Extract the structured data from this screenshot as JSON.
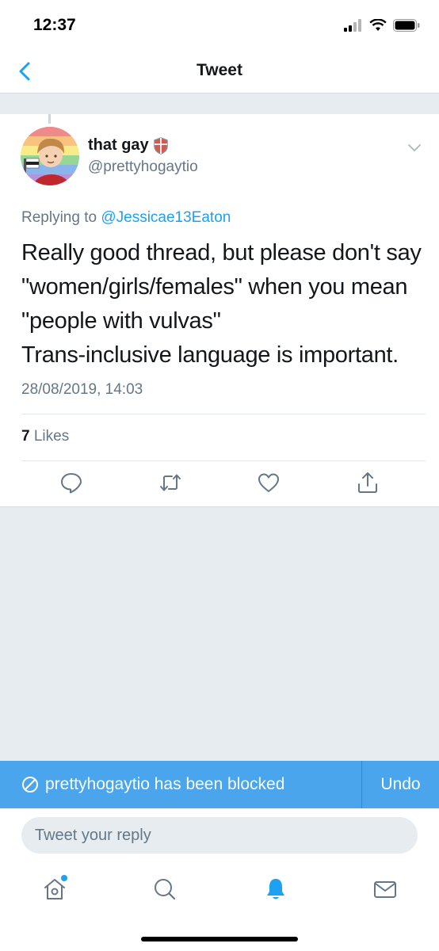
{
  "status_bar": {
    "time": "12:37"
  },
  "nav": {
    "title": "Tweet",
    "back_icon": "chevron-left-icon"
  },
  "tweet": {
    "display_name": "that gay",
    "handle": "@prettyhogaytio",
    "replying_label": "Replying to",
    "replying_to": "@Jessicae13Eaton",
    "text_lines": [
      "Really good thread, but please don't say",
      "\"women/girls/females\" when you mean",
      "\"people with vulvas\"",
      "Trans-inclusive language is important."
    ],
    "timestamp": "28/08/2019, 14:03",
    "likes_count": "7",
    "likes_label": "Likes",
    "actions": [
      "reply-icon",
      "retweet-icon",
      "like-icon",
      "share-icon"
    ]
  },
  "banner": {
    "text": "prettyhogaytio has been blocked",
    "undo_label": "Undo"
  },
  "reply": {
    "placeholder": "Tweet your reply"
  },
  "tab_bar": {
    "tabs": [
      "home-icon",
      "search-icon",
      "notifications-icon",
      "messages-icon"
    ],
    "active": "notifications-icon"
  },
  "colors": {
    "accent": "#1da1f2",
    "banner": "#4aa5ec",
    "secondary_text": "#657786",
    "background": "#e6ecf0"
  }
}
